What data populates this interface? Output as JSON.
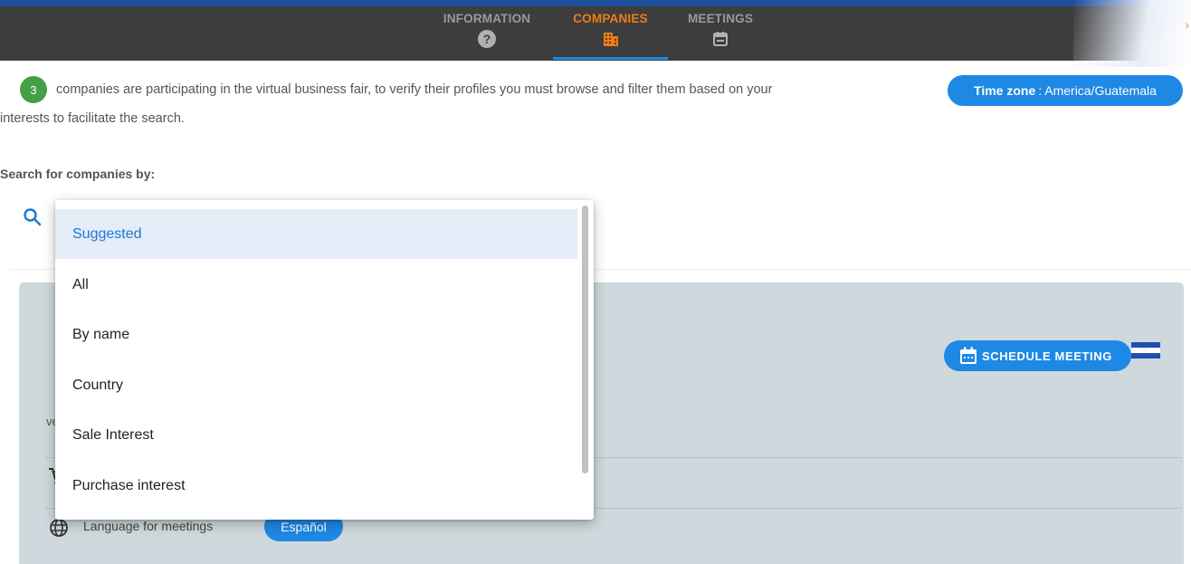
{
  "nav": {
    "tabs": [
      {
        "label": "INFORMATION",
        "icon": "help-circle-icon"
      },
      {
        "label": "COMPANIES",
        "icon": "building-icon",
        "active": true
      },
      {
        "label": "MEETINGS",
        "icon": "calendar-icon"
      }
    ],
    "more": "›",
    "active_color": "#ef7c16",
    "accent_color": "#1e88e5"
  },
  "intro": {
    "count": "3",
    "text_line1": "companies are participating in the virtual business fair, to verify their profiles you must browse and filter them based on your",
    "text_line2": "interests to facilitate the search."
  },
  "timezone": {
    "label": "Time zone",
    "value": ": America/Guatemala"
  },
  "search": {
    "title": "Search for companies by:",
    "options": [
      "Suggested",
      "All",
      "By name",
      "Country",
      "Sale Interest",
      "Purchase interest"
    ],
    "selected": "Suggested"
  },
  "card": {
    "schedule_label": "SCHEDULE MEETING",
    "truncated_text": "ve",
    "language_label": "Language for meetings",
    "language_value": "Español"
  }
}
